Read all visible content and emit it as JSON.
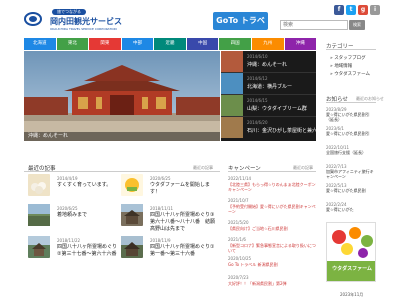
{
  "header": {
    "logo_badge": "旅でつながる",
    "logo_name": "岡内田観光サービス",
    "logo_en": "OKAUCHIDA TRAVEL SERVICE CORPORATION",
    "goto_label": "GoTo トラベル",
    "search_placeholder": "検索",
    "search_button": "検索",
    "social": [
      {
        "label": "f",
        "color": "#3b5998"
      },
      {
        "label": "t",
        "color": "#1da1f2"
      },
      {
        "label": "g",
        "color": "#dd4b39"
      },
      {
        "label": "i",
        "color": "#999999"
      }
    ]
  },
  "nav": [
    {
      "label": "北海道",
      "color": "#1e88e5"
    },
    {
      "label": "東北",
      "color": "#43a047"
    },
    {
      "label": "関東",
      "color": "#e53935"
    },
    {
      "label": "中部",
      "color": "#1e88e5"
    },
    {
      "label": "近畿",
      "color": "#00897b"
    },
    {
      "label": "中国",
      "color": "#3949ab"
    },
    {
      "label": "四国",
      "color": "#43a047"
    },
    {
      "label": "九州",
      "color": "#fb8c00"
    },
    {
      "label": "沖縄",
      "color": "#8e24aa"
    }
  ],
  "hero": {
    "caption": "沖縄：めんそーれ"
  },
  "slides": [
    {
      "date": "2014/6/10",
      "title": "沖縄：めんそーれ",
      "color": "#b35a3c"
    },
    {
      "date": "2014/6/12",
      "title": "北海道：横丹ブルー",
      "color": "#4d8fc0"
    },
    {
      "date": "2014/6/15",
      "title": "山梨：ウタダイブリーム群",
      "color": "#6c8e4b"
    },
    {
      "date": "2014/6/20",
      "title": "石川：金沢ひがし茶屋街と兼六園",
      "color": "#a07a4c"
    }
  ],
  "sidebar": {
    "category_heading": "カテゴリー",
    "categories": [
      "スタッフブログ",
      "地域情報",
      "ウタダスファーム"
    ],
    "news_heading": "お知らせ",
    "news_more": "最近のお知らせ",
    "news": [
      {
        "date": "2023/8/29",
        "title": "愛☆得にいがた県民割引（延長）"
      },
      {
        "date": "2023/6/1",
        "title": "愛☆得にいがた県民割引"
      },
      {
        "date": "2022/10/11",
        "title": "全国旅行支援（延長）"
      },
      {
        "date": "2022/7/13",
        "title": "加賀市アフィニティ旅行キャンペーン"
      },
      {
        "date": "2022/5/13",
        "title": "愛☆得にいがた県民割"
      },
      {
        "date": "2022/2/24",
        "title": "愛☆得にいがた"
      }
    ],
    "banner_label": "ウタダスファーム",
    "footer_date": "2023年11月"
  },
  "recent": {
    "heading": "最近の記事",
    "more": "最近の記事",
    "posts": [
      {
        "date": "2014/4/19",
        "title": "すくすく育っています。"
      },
      {
        "date": "2020/6/25",
        "title": "ウタダファームを開始します！"
      },
      {
        "date": "2020/6/25",
        "title": "着地頼みまで"
      },
      {
        "date": "2018/11/11",
        "title": "四国八十八ヶ所霊場めぐり③第六十八番～八十八番　結願高野山は先まで"
      },
      {
        "date": "2018/11/22",
        "title": "四国八十八ヶ所霊場めぐり②第三十七番～第六十六番"
      },
      {
        "date": "2018/11/9",
        "title": "四国八十八ヶ所霊場めぐり①第一番～第三十六番"
      }
    ]
  },
  "campaign": {
    "heading": "キャンペーン",
    "more": "最近の記事",
    "items": [
      {
        "date": "2022/11/14",
        "title": "【北陸三県】もらっ得☆りのんまぁ北陸クーポンキャンペーン"
      },
      {
        "date": "2021/10/7",
        "title": "【予約受付開始】愛☆得にいがた県民割キャンペーン"
      },
      {
        "date": "2021/5/20",
        "title": "【県民向け】ご当地☆石川県民割"
      },
      {
        "date": "2021/1/6",
        "title": "【新型コロナ】緊急事態宣言による取り扱いについて"
      },
      {
        "date": "2020/10/25",
        "title": "Go To トラベル 新潟県民割"
      },
      {
        "date": "2020/7/23",
        "title": "大好評！！「新潟県民割」第2弾"
      }
    ]
  }
}
